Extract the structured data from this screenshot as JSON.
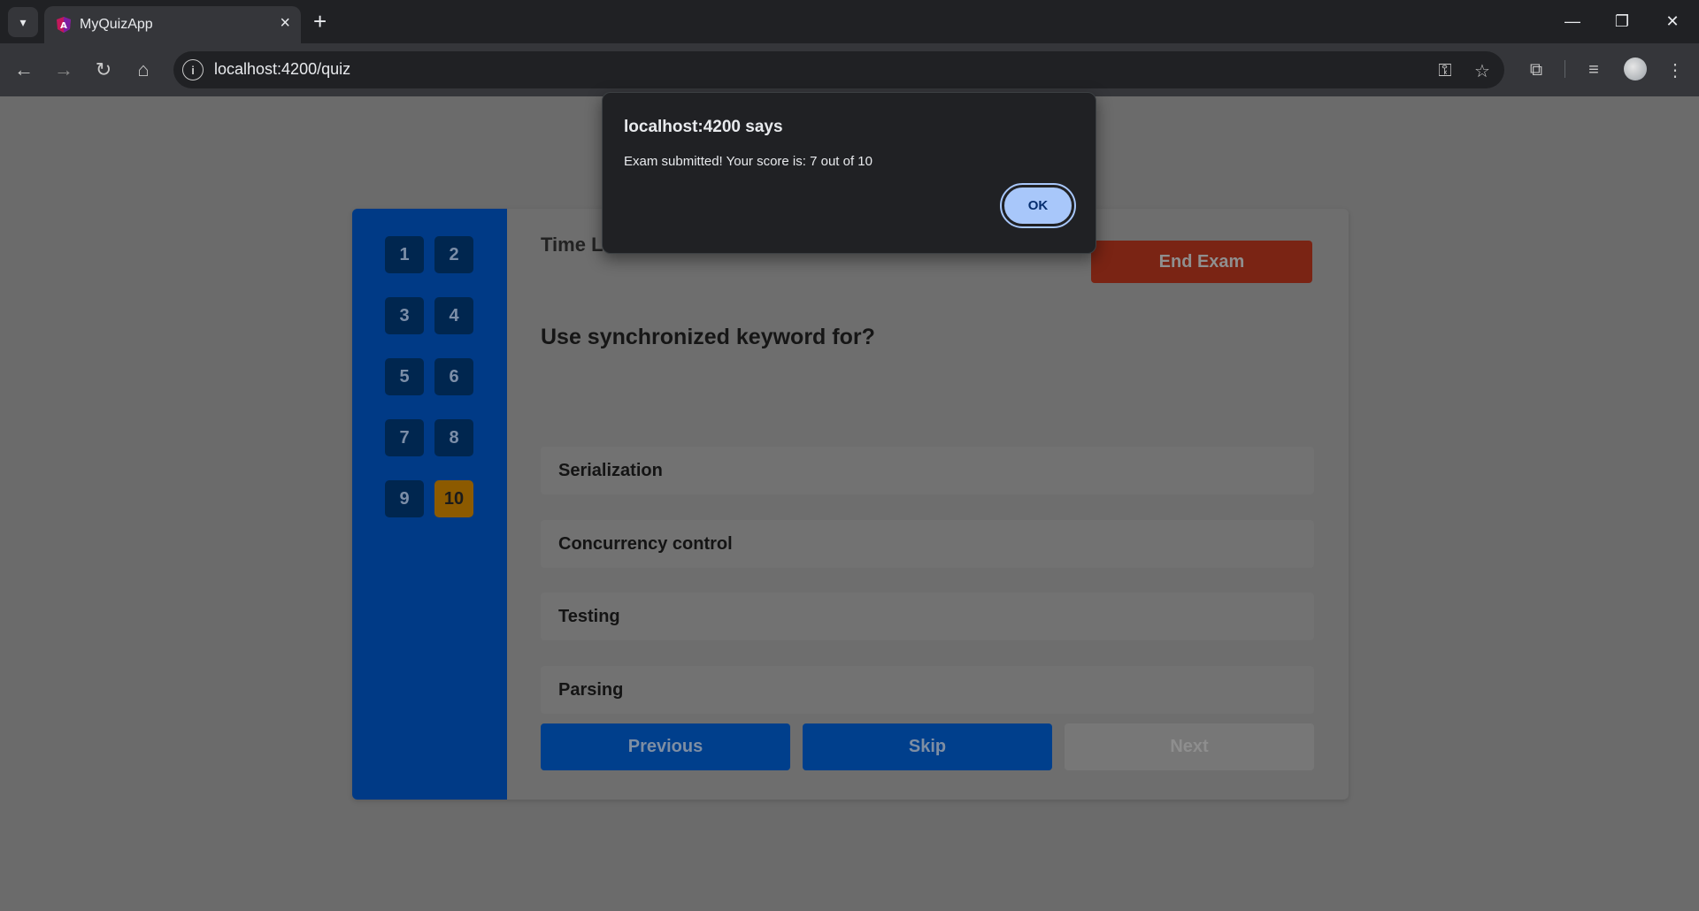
{
  "browser": {
    "tab_title": "MyQuizApp",
    "url": "localhost:4200/quiz"
  },
  "quiz": {
    "question_numbers": [
      "1",
      "2",
      "3",
      "4",
      "5",
      "6",
      "7",
      "8",
      "9",
      "10"
    ],
    "current_question": "10",
    "timer_label": "Time L",
    "end_exam_label": "End Exam",
    "question": "Use synchronized keyword for?",
    "options": [
      "Serialization",
      "Concurrency control",
      "Testing",
      "Parsing"
    ],
    "previous_label": "Previous",
    "skip_label": "Skip",
    "next_label": "Next"
  },
  "dialog": {
    "title": "localhost:4200 says",
    "message": "Exam submitted! Your score is: 7 out of 10",
    "ok_label": "OK"
  },
  "colors": {
    "sidebar": "#003a86",
    "active_question": "#8c5a00",
    "end_exam": "#7a2414",
    "ok_button": "#a8c7fa"
  }
}
